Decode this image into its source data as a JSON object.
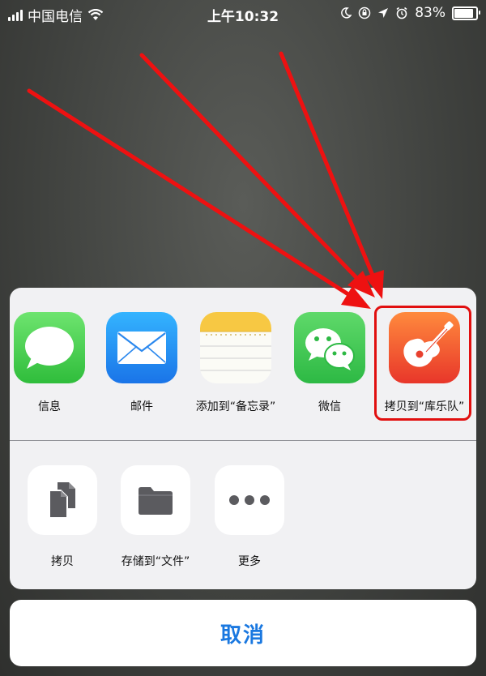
{
  "status_bar": {
    "carrier": "中国电信",
    "time": "上午10:32",
    "battery": "83%",
    "battery_level": 0.83
  },
  "share_sheet": {
    "apps": [
      {
        "label": "信息",
        "icon": "messages-icon"
      },
      {
        "label": "邮件",
        "icon": "mail-icon"
      },
      {
        "label": "添加到“备忘录”",
        "icon": "notes-icon"
      },
      {
        "label": "微信",
        "icon": "wechat-icon"
      },
      {
        "label": "拷贝到“库乐队”",
        "icon": "garageband-icon"
      }
    ],
    "actions": [
      {
        "label": "拷贝",
        "icon": "copy-icon"
      },
      {
        "label": "存储到“文件”",
        "icon": "folder-icon"
      },
      {
        "label": "更多",
        "icon": "more-icon"
      }
    ]
  },
  "cancel_label": "取消",
  "colors": {
    "accent": "#1a78e0",
    "highlight": "#e10f0f"
  }
}
